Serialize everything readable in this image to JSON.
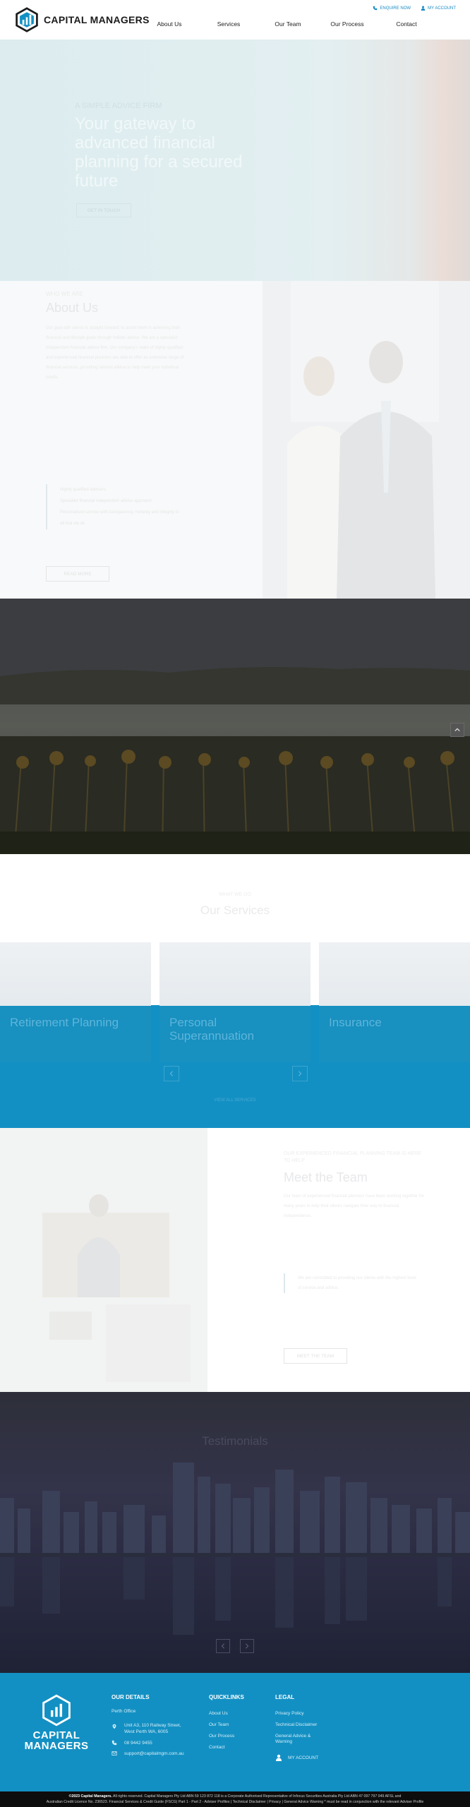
{
  "brand": {
    "name": "CAPITAL MANAGERS",
    "footer_name_line1": "CAPITAL",
    "footer_name_line2": "MANAGERS",
    "accent": "#1390c3"
  },
  "util": {
    "enquire": "ENQUIRE NOW",
    "account": "MY ACCOUNT"
  },
  "nav": [
    "About Us",
    "Services",
    "Our Team",
    "Our Process",
    "Contact"
  ],
  "hero": {
    "kicker": "A SIMPLE ADVICE FIRM",
    "title": "Your gateway to advanced financial planning for a secured future",
    "button": "GET IN TOUCH"
  },
  "about": {
    "kicker": "WHO WE ARE",
    "title": "About Us",
    "body": "Our goal with clients is straight forward: to assist them in achieving their financial and lifestyle goals through holistic advice. We are a specialist independent financial advice firm. Our company's team of highly qualified and experienced financial planners are able to offer an extensive range of financial services, providing tailored advice to help meet your individual needs.",
    "list": [
      "Highly qualified advisers",
      "Specialist financial independent advice approach",
      "Personalised service with transparency, honesty and integrity in all that we do"
    ],
    "button": "READ MORE"
  },
  "services": {
    "kicker": "WHAT WE DO",
    "title": "Our Services",
    "items": [
      "Retirement Planning",
      "Personal Superannuation",
      "Insurance"
    ],
    "more": "VIEW ALL SERVICES"
  },
  "team": {
    "kicker": "OUR EXPERIENCED FINANCIAL PLANNING TEAM IS HERE TO HELP",
    "title": "Meet the Team",
    "body": "Our team of experienced financial planners have been working together for many years to help their clients navigate their way to financial independence.",
    "quote": "We are committed to providing our clients with the highest level of service and advice.",
    "button": "MEET THE TEAM"
  },
  "testimonials": {
    "title": "Testimonials"
  },
  "footer": {
    "details_heading": "OUR DETAILS",
    "office": "Perth Office",
    "address_line1": "Unit A3, 110 Railway Street,",
    "address_line2": "West Perth WA, 6005",
    "phone": "08 9442 9455",
    "email": "support@capitalmgm.com.au",
    "quicklinks_heading": "QUICKLINKS",
    "quicklinks": [
      "About Us",
      "Our Team",
      "Our Process",
      "Contact"
    ],
    "legal_heading": "LEGAL",
    "legal": [
      "Privacy Policy",
      "Technical Disclaimer",
      "General Advice &",
      "Warning"
    ],
    "account": "MY ACCOUNT"
  },
  "copyright": {
    "year_brand": "©2023 Capital Managers.",
    "line1": "All rights reserved. Capital Managers Pty Ltd ABN 59 123 872 118 is a Corporate Authorised Representative of Infocus Securities Australia Pty Ltd ABN 47 097 797 049 AFSL and",
    "line2": "Australian Credit Licence No. 236523. Financial Services & Credit Guide (FSCG) Part 1 - Part 2 - Adviser Profiles | Technical Disclaimer | Privacy | General Advice Warning * must be read in conjunction with the relevant Adviser Profile"
  }
}
